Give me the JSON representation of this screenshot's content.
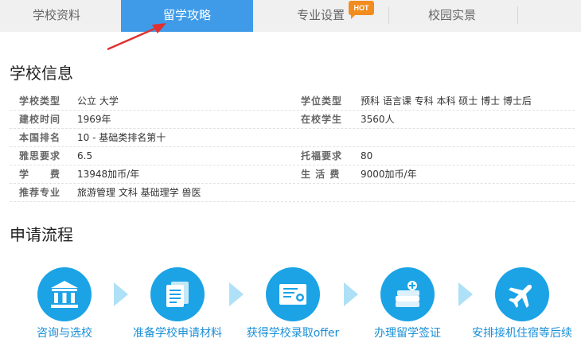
{
  "tabs": [
    {
      "label": "学校资料",
      "active": false
    },
    {
      "label": "留学攻略",
      "active": true
    },
    {
      "label": "专业设置",
      "active": false,
      "badge": "HOT"
    },
    {
      "label": "校园实景",
      "active": false
    }
  ],
  "colors": {
    "accent": "#3f9be8",
    "step_circle": "#1ba3e6",
    "step_label": "#1a8fd6",
    "badge": "#f28c1e",
    "annotation_arrow": "#e03030"
  },
  "school_info": {
    "title": "学校信息",
    "rows": [
      {
        "label_left": "学校类型",
        "value_left": "公立 大学",
        "label_right": "学位类型",
        "value_right": "预科 语言课 专科 本科 硕士 博士 博士后"
      },
      {
        "label_left": "建校时间",
        "value_left": "1969年",
        "label_right": "在校学生",
        "value_right": "3560人"
      },
      {
        "label_left": "本国排名",
        "value_left": "10 - 基础类排名第十",
        "label_right": "",
        "value_right": ""
      },
      {
        "label_left": "雅思要求",
        "value_left": "6.5",
        "label_right": "托福要求",
        "value_right": "80"
      },
      {
        "label_left": "学　　费",
        "value_left": "13948加币/年",
        "label_right": "生 活 费",
        "value_right": "9000加币/年"
      },
      {
        "label_left": "推荐专业",
        "value_left": "旅游管理 文科 基础理学 兽医",
        "label_right": "",
        "value_right": ""
      }
    ]
  },
  "process": {
    "title": "申请流程",
    "steps": [
      {
        "label": "咨询与选校",
        "icon": "bank-icon"
      },
      {
        "label": "准备学校申请材料",
        "icon": "documents-icon"
      },
      {
        "label": "获得学校录取offer",
        "icon": "certificate-icon"
      },
      {
        "label": "办理留学签证",
        "icon": "passport-icon"
      },
      {
        "label": "安排接机住宿等后续",
        "icon": "airplane-icon"
      }
    ]
  }
}
